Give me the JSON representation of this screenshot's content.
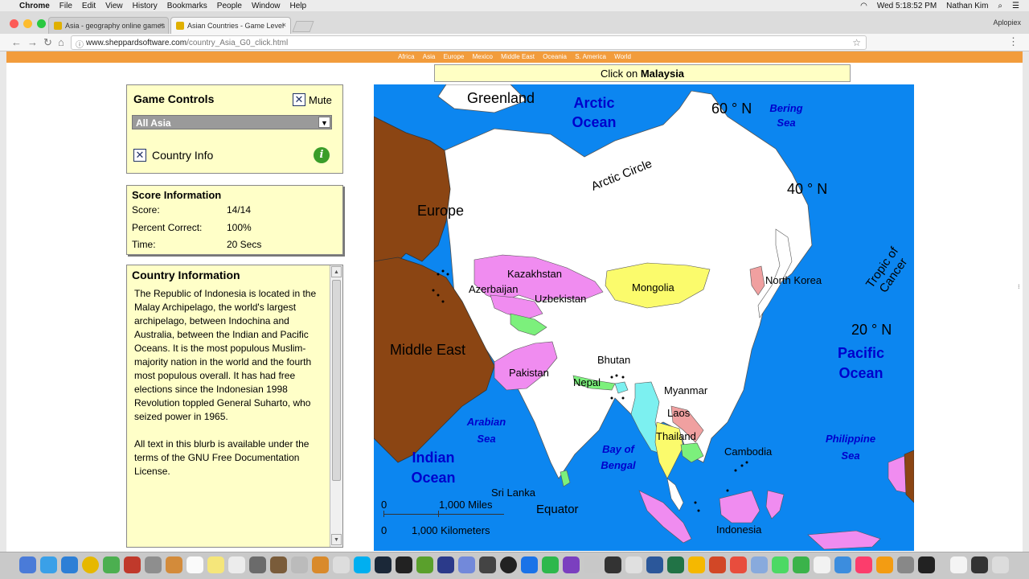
{
  "menubar": {
    "app_name": "Chrome",
    "items": [
      "File",
      "Edit",
      "View",
      "History",
      "Bookmarks",
      "People",
      "Window",
      "Help"
    ],
    "clock": "Wed 5:18:52 PM",
    "user": "Nathan Kim"
  },
  "browser": {
    "tabs": [
      {
        "title": "Asia - geography online games",
        "active": false
      },
      {
        "title": "Asian Countries - Game Level",
        "active": true
      }
    ],
    "profile": "Aplopiex",
    "url_host": "www.sheppardsoftware.com",
    "url_path": "/country_Asia_G0_click.html"
  },
  "site_nav": [
    "Africa",
    "Asia",
    "Europe",
    "Mexico",
    "Middle East",
    "Oceania",
    "S. America",
    "World"
  ],
  "prompt": {
    "prefix": "Click on ",
    "target": "Malaysia"
  },
  "game_controls": {
    "title": "Game Controls",
    "mute_label": "Mute",
    "mute_checked": true,
    "region_selected": "All Asia",
    "country_info_label": "Country Info",
    "country_info_checked": true,
    "info_icon_glyph": "i"
  },
  "score": {
    "title": "Score Information",
    "rows": [
      {
        "label": "Score:",
        "value": "14/14"
      },
      {
        "label": "Percent Correct:",
        "value": "100%"
      },
      {
        "label": "Time:",
        "value": "20 Secs"
      }
    ]
  },
  "country_info": {
    "title": "Country Information",
    "paragraph1": "The Republic of Indonesia is located in the Malay Archipelago, the world's largest archipelago, between Indochina and Australia, between the Indian and Pacific Oceans. It is the most populous Muslim-majority nation in the world and the fourth most populous overall. It has had free elections since the Indonesian 1998 Revolution toppled General Suharto, who seized power in 1965.",
    "paragraph2": "All text in this blurb is available under the terms of the GNU Free Documentation License."
  },
  "map": {
    "water_labels": [
      "Arctic Ocean",
      "Bering Sea",
      "Pacific Ocean",
      "Indian Ocean",
      "Arabian Sea",
      "Bay of Bengal",
      "Philippine Sea"
    ],
    "region_labels": [
      "Greenland",
      "Europe",
      "Middle East"
    ],
    "country_labels": [
      "Kazakhstan",
      "Azerbaijan",
      "Uzbekistan",
      "Mongolia",
      "North Korea",
      "Pakistan",
      "Bhutan",
      "Nepal",
      "Myanmar",
      "Laos",
      "Thailand",
      "Cambodia",
      "Sri Lanka",
      "Indonesia"
    ],
    "lines": [
      "Arctic Circle",
      "Tropic of Cancer",
      "Equator"
    ],
    "latitudes": [
      "60 ° N",
      "40 ° N",
      "20 ° N"
    ],
    "scale": {
      "zero": "0",
      "miles": "1,000 Miles",
      "km": "1,000 Kilometers"
    },
    "colors": {
      "water": "#0c86f0",
      "land": "#ffffff",
      "region": "#8b4513",
      "pink": "#f08cf0",
      "green": "#7cf07c",
      "yellow": "#fbfb6c",
      "cyan": "#7cf0f0",
      "salmon": "#f0a0a0"
    }
  }
}
